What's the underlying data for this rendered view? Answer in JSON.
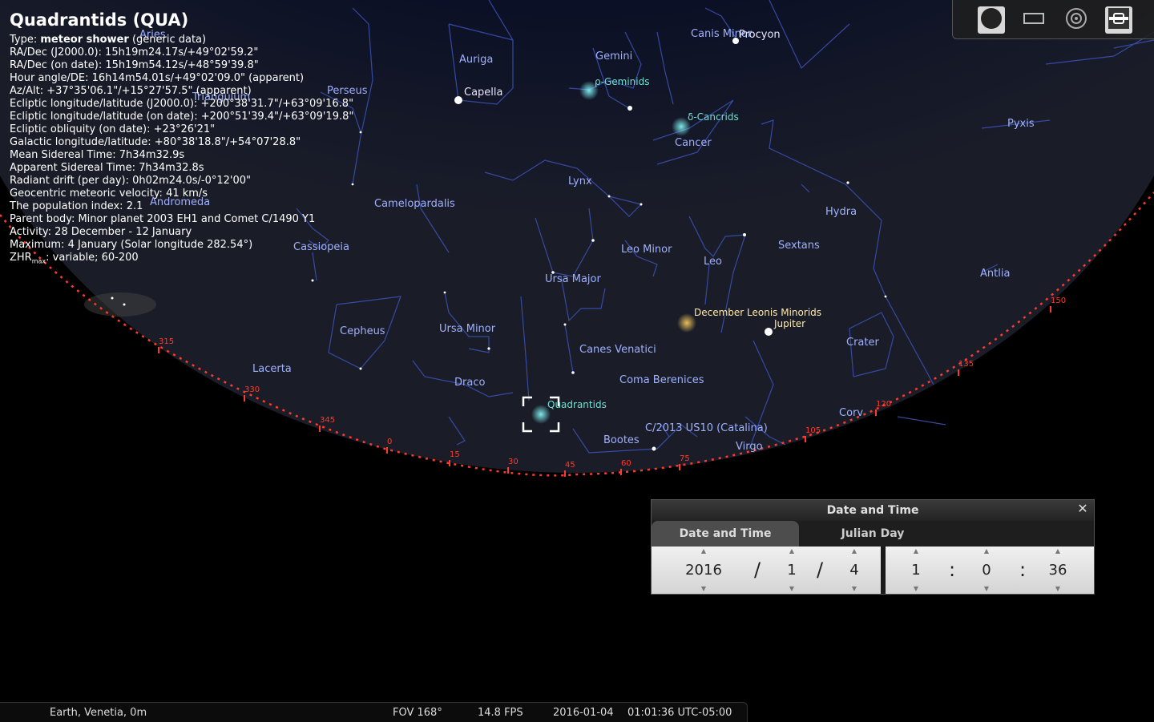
{
  "info": {
    "title": "Quadrantids (QUA)",
    "type_prefix": "Type: ",
    "type_value": "meteor shower",
    "type_suffix": " (generic data)",
    "lines": [
      "RA/Dec (J2000.0): 15h19m24.17s/+49°02'59.2\"",
      "RA/Dec (on date): 15h19m54.12s/+48°59'39.8\"",
      "Hour angle/DE: 16h14m54.01s/+49°02'09.0\" (apparent)",
      "Az/Alt: +37°35'06.1\"/+15°27'57.5\" (apparent)",
      "Ecliptic longitude/latitude (J2000.0): +200°38'31.7\"/+63°09'16.8\"",
      "Ecliptic longitude/latitude (on date): +200°51'39.4\"/+63°09'19.8\"",
      "Ecliptic obliquity (on date): +23°26'21\"",
      "Galactic longitude/latitude: +80°38'18.8\"/+54°07'28.8\"",
      "Mean Sidereal Time: 7h34m32.9s",
      "Apparent Sidereal Time: 7h34m32.8s",
      "Radiant drift (per day): 0h02m24.0s/-0°12'00\"",
      "Geocentric meteoric velocity: 41 km/s",
      "The population index: 2.1",
      "Parent body: Minor planet 2003 EH1 and Comet C/1490 Y1",
      "Activity: 28 December - 12 January",
      "Maximum: 4 January (Solar longitude 282.54°)"
    ],
    "zhr_prefix": "ZHR",
    "zhr_sub": "max",
    "zhr_value": ": variable; 60-200"
  },
  "sky": {
    "constellations": {
      "aries": "Aries",
      "auriga": "Auriga",
      "gemini": "Gemini",
      "canis_minor": "Canis Minor",
      "perseus": "Perseus",
      "triangulum": "Triangulum",
      "cancer": "Cancer",
      "pyxis": "Pyxis",
      "lynx": "Lynx",
      "camelopardalis": "Camelopardalis",
      "andromeda": "Andromeda",
      "hydra": "Hydra",
      "cassiopeia": "Cassiopeia",
      "leo_minor": "Leo Minor",
      "sextans": "Sextans",
      "leo": "Leo",
      "antlia": "Antlia",
      "ursa_major": "Ursa Major",
      "cepheus": "Cepheus",
      "ursa_minor": "Ursa Minor",
      "canes_venatici": "Canes Venatici",
      "crater": "Crater",
      "lacerta": "Lacerta",
      "draco": "Draco",
      "coma_berenices": "Coma Berenices",
      "corvus": "Corv",
      "bootes": "Bootes",
      "virgo": "Virgo"
    },
    "stars": {
      "procyon": "Procyon",
      "capella": "Capella"
    },
    "meteor_showers": {
      "rho_geminids": "ρ-Geminids",
      "delta_cancrids": "δ-Cancrids",
      "december_leonis_minorids": "December Leonis Minorids",
      "quadrantids": "Quadrantids"
    },
    "planets": {
      "jupiter": "Jupiter"
    },
    "comets": {
      "catalina": "C/2013 US10 (Catalina)"
    },
    "azimuth_labels": [
      "315",
      "330",
      "345",
      "0",
      "15",
      "30",
      "45",
      "60",
      "75",
      "105",
      "120",
      "135",
      "150"
    ],
    "colors": {
      "constellation_line": "#3a4fb0",
      "constellation_label": "#9fb0ff",
      "horizon": "#ff3a2a",
      "meteor_label": "#6ee0d2",
      "planet_label": "#ffe9a8"
    }
  },
  "toolbar": {
    "buttons": [
      {
        "icon": "planet-view-icon",
        "active": true
      },
      {
        "icon": "rectangle-icon",
        "active": false
      },
      {
        "icon": "target-icon",
        "active": false
      },
      {
        "icon": "eyepiece-icon",
        "active": true
      }
    ]
  },
  "date_time_dialog": {
    "title": "Date and Time",
    "tabs": [
      "Date and Time",
      "Julian Day"
    ],
    "year": "2016",
    "month": "1",
    "day": "4",
    "hour": "1",
    "minute": "0",
    "second": "36",
    "date_sep": "/",
    "time_sep": ":"
  },
  "status": {
    "location": "Earth, Venetia, 0m",
    "fov": "FOV 168°",
    "fps": "14.8 FPS",
    "date": "2016-01-04",
    "time": "01:01:36 UTC-05:00"
  }
}
